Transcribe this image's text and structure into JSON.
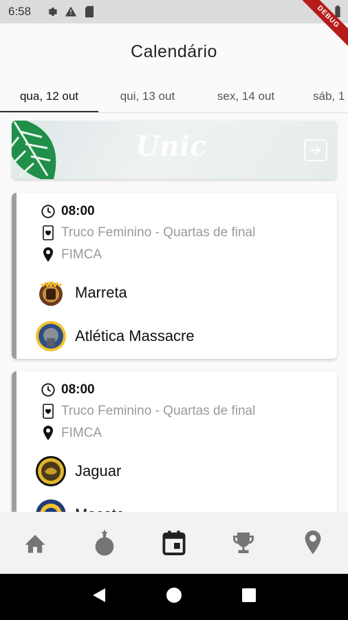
{
  "status": {
    "time": "6:58",
    "debug": "DEBUG"
  },
  "app": {
    "title": "Calendário"
  },
  "tabs": [
    {
      "label": "qua, 12 out",
      "active": true
    },
    {
      "label": "qui, 13 out",
      "active": false
    },
    {
      "label": "sex, 14 out",
      "active": false
    },
    {
      "label": "sáb, 1",
      "active": false
    }
  ],
  "banner": {
    "logo_text": "Unic"
  },
  "matches": [
    {
      "time": "08:00",
      "event": "Truco Feminino - Quartas de final",
      "location": "FIMCA",
      "teams": [
        {
          "name": "Marreta"
        },
        {
          "name": "Atlética Massacre"
        }
      ]
    },
    {
      "time": "08:00",
      "event": "Truco Feminino - Quartas de final",
      "location": "FIMCA",
      "teams": [
        {
          "name": "Jaguar"
        },
        {
          "name": "Macete"
        }
      ]
    }
  ],
  "nav": {
    "items": [
      "home-icon",
      "bomb-icon",
      "calendar-icon",
      "trophy-icon",
      "location-pin-icon"
    ],
    "active": "calendar-icon"
  },
  "colors": {
    "accent": "#9e9e9e",
    "active_icon": "#212121",
    "inactive_icon": "#757575"
  }
}
